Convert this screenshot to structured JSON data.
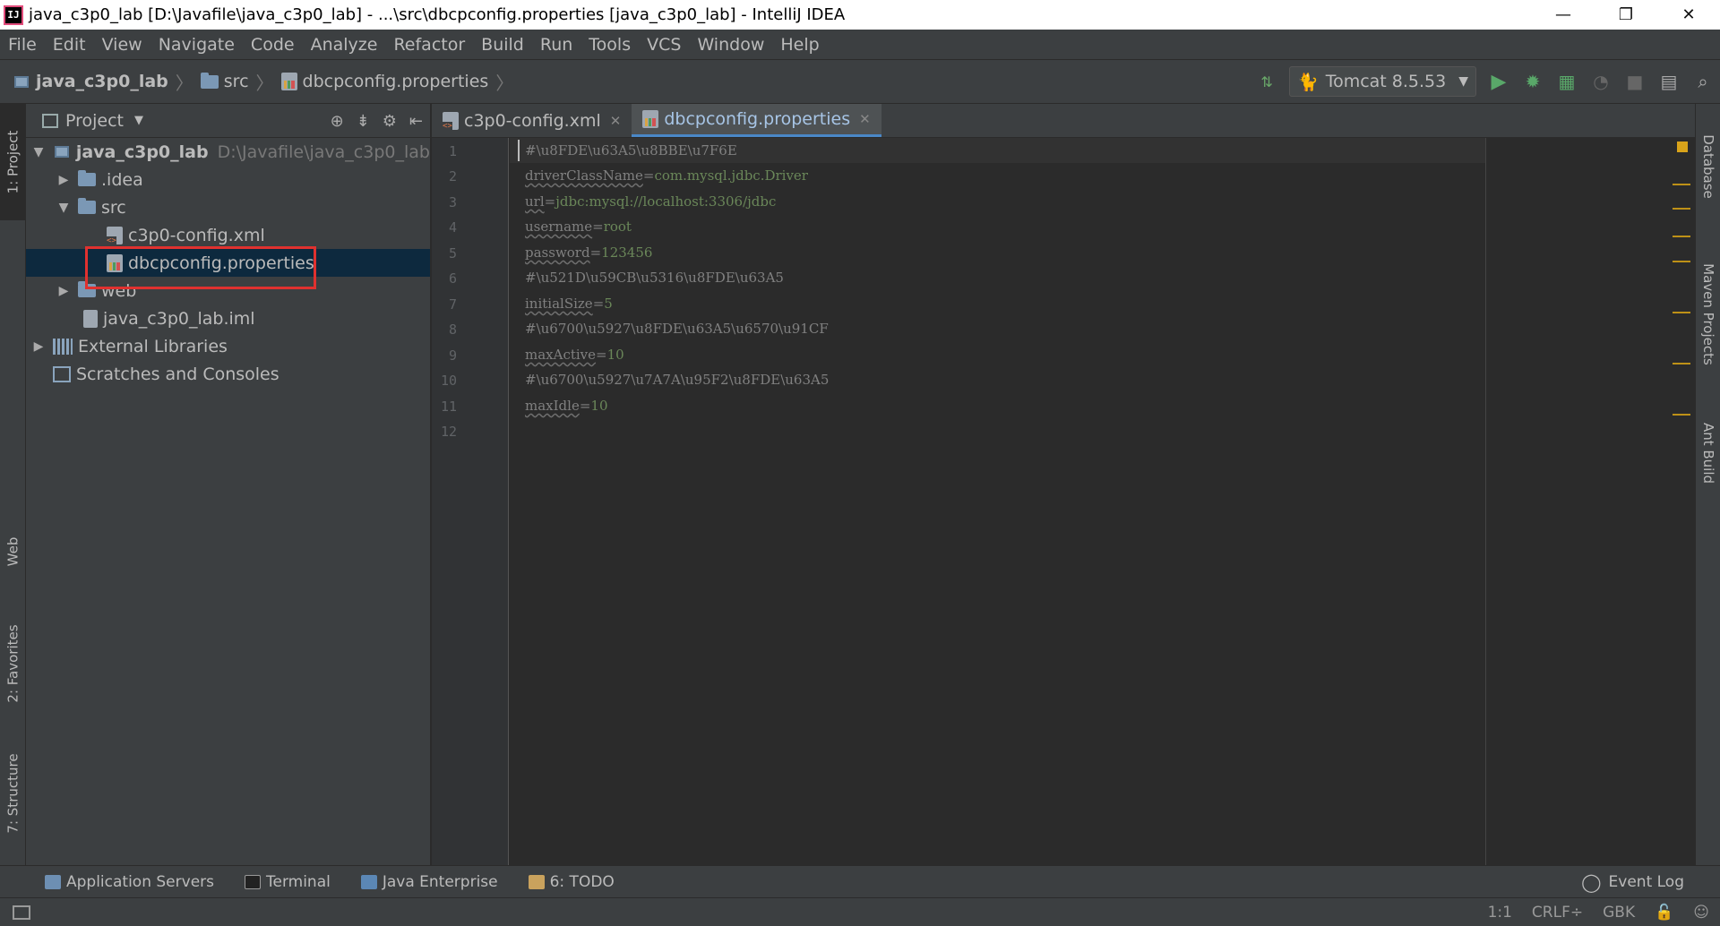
{
  "window": {
    "title": "java_c3p0_lab [D:\\Javafile\\java_c3p0_lab] - ...\\src\\dbcpconfig.properties [java_c3p0_lab] - IntelliJ IDEA",
    "app_icon": "IJ",
    "minimize": "—",
    "restore": "❐",
    "close": "✕"
  },
  "menu": [
    "File",
    "Edit",
    "View",
    "Navigate",
    "Code",
    "Analyze",
    "Refactor",
    "Build",
    "Run",
    "Tools",
    "VCS",
    "Window",
    "Help"
  ],
  "breadcrumb": {
    "project": "java_c3p0_lab",
    "folder": "src",
    "file": "dbcpconfig.properties"
  },
  "run_config": {
    "label": "Tomcat 8.5.53"
  },
  "left_tabs": {
    "project": "1: Project",
    "web": "Web",
    "favorites": "2: Favorites",
    "structure": "7: Structure"
  },
  "right_tabs": {
    "database": "Database",
    "maven": "Maven Projects",
    "ant": "Ant Build"
  },
  "project_panel": {
    "title": "Project",
    "tree": [
      {
        "label": "java_c3p0_lab",
        "path": "D:\\Javafile\\java_c3p0_lab"
      },
      {
        "label": ".idea"
      },
      {
        "label": "src"
      },
      {
        "label": "c3p0-config.xml"
      },
      {
        "label": "dbcpconfig.properties"
      },
      {
        "label": "web"
      },
      {
        "label": "java_c3p0_lab.iml"
      },
      {
        "label": "External Libraries"
      },
      {
        "label": "Scratches and Consoles"
      }
    ]
  },
  "editor_tabs": [
    {
      "label": "c3p0-config.xml"
    },
    {
      "label": "dbcpconfig.properties",
      "active": true
    }
  ],
  "editor": {
    "lines": [
      {
        "n": "1",
        "comment": "#\\u8FDE\\u63A5\\u8BBE\\u7F6E"
      },
      {
        "n": "2",
        "key": "driverClassName",
        "value": "com.mysql.jdbc.Driver"
      },
      {
        "n": "3",
        "key": "url",
        "value": "jdbc:mysql://localhost:3306/jdbc"
      },
      {
        "n": "4",
        "key": "username",
        "value": "root"
      },
      {
        "n": "5",
        "key": "password",
        "value": "123456"
      },
      {
        "n": "6",
        "comment": "#\\u521D\\u59CB\\u5316\\u8FDE\\u63A5"
      },
      {
        "n": "7",
        "key": "initialSize",
        "value": "5"
      },
      {
        "n": "8",
        "comment": "#\\u6700\\u5927\\u8FDE\\u63A5\\u6570\\u91CF"
      },
      {
        "n": "9",
        "key": "maxActive",
        "value": "10"
      },
      {
        "n": "10",
        "comment": "#\\u6700\\u5927\\u7A7A\\u95F2\\u8FDE\\u63A5"
      },
      {
        "n": "11",
        "key": "maxIdle",
        "value": "10"
      },
      {
        "n": "12"
      }
    ]
  },
  "bottom_tools": {
    "app_servers": "Application Servers",
    "terminal": "Terminal",
    "java_enterprise": "Java Enterprise",
    "todo": "6: TODO",
    "event_log": "Event Log"
  },
  "status": {
    "position": "1:1",
    "line_separator": "CRLF÷",
    "encoding": "GBK"
  },
  "colors": {
    "accent": "#4a88c7",
    "highlight_box": "#e0312f",
    "string_value": "#6a8759",
    "warning_mark": "#be9117"
  }
}
